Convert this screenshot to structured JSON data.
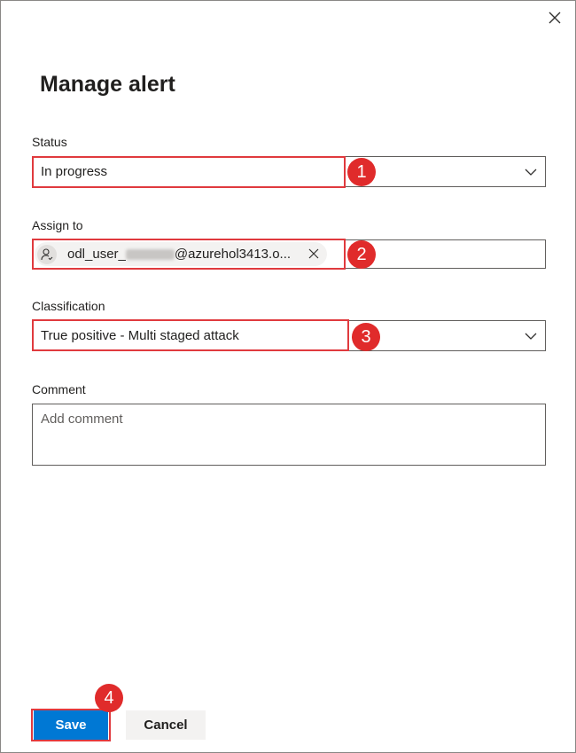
{
  "dialog": {
    "title": "Manage alert",
    "close_icon": "close-icon"
  },
  "status": {
    "label": "Status",
    "value": "In progress"
  },
  "assign": {
    "label": "Assign to",
    "user_prefix": "odl_user_",
    "user_suffix": "@azurehol3413.o..."
  },
  "classification": {
    "label": "Classification",
    "value": "True positive - Multi staged attack"
  },
  "comment": {
    "label": "Comment",
    "placeholder": "Add comment"
  },
  "buttons": {
    "save": "Save",
    "cancel": "Cancel"
  },
  "annotations": [
    "1",
    "2",
    "3",
    "4"
  ],
  "colors": {
    "accent": "#0078d4",
    "highlight": "#e03a3e",
    "badge": "#e02b2b"
  }
}
